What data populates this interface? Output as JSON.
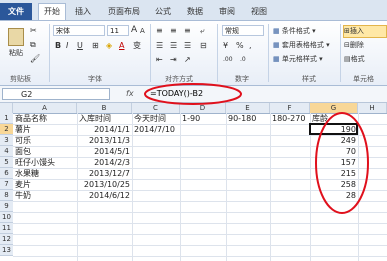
{
  "tabs": [
    "文件",
    "开始",
    "插入",
    "页面布局",
    "公式",
    "数据",
    "审阅",
    "视图"
  ],
  "ribbon": {
    "clipboard": {
      "paste": "粘贴",
      "label": "剪贴板"
    },
    "font": {
      "name": "宋体",
      "size": "11",
      "label": "字体",
      "bold": "B",
      "italic": "I",
      "underline": "U",
      "grow": "A",
      "shrink": "A",
      "color": "A",
      "phonetic": "变"
    },
    "alignment": {
      "label": "对齐方式"
    },
    "number": {
      "format": "常规",
      "currency": "%",
      "label": "数字"
    },
    "styles": {
      "conditional": "条件格式",
      "table": "套用表格格式",
      "cell": "单元格样式",
      "label": "样式"
    },
    "cells": {
      "insert": "插入",
      "delete": "删除",
      "format": "格式",
      "label": "单元格"
    }
  },
  "formula_bar": {
    "name_box": "G2",
    "fx": "fx",
    "formula": "=TODAY()-B2"
  },
  "columns": [
    "A",
    "B",
    "C",
    "D",
    "E",
    "F",
    "G",
    "H"
  ],
  "rows": [
    "1",
    "2",
    "3",
    "4",
    "5",
    "6",
    "7",
    "8",
    "9",
    "10",
    "11",
    "12",
    "13"
  ],
  "header_row": [
    "商品名称",
    "入库时间",
    "今天时间",
    "1-90",
    "90-180",
    "180-270",
    "库龄"
  ],
  "today_value": "2014/7/10",
  "data": [
    {
      "name": "薯片",
      "date": "2014/1/1",
      "age": "190"
    },
    {
      "name": "可乐",
      "date": "2013/11/3",
      "age": "249"
    },
    {
      "name": "面包",
      "date": "2014/5/1",
      "age": "70"
    },
    {
      "name": "旺仔小馒头",
      "date": "2014/2/3",
      "age": "157"
    },
    {
      "name": "水果糖",
      "date": "2013/12/7",
      "age": "215"
    },
    {
      "name": "麦片",
      "date": "2013/10/25",
      "age": "258"
    },
    {
      "name": "牛奶",
      "date": "2014/6/12",
      "age": "28"
    }
  ],
  "colors": {
    "annotation": "#e0101c",
    "file_tab": "#2b579a"
  }
}
